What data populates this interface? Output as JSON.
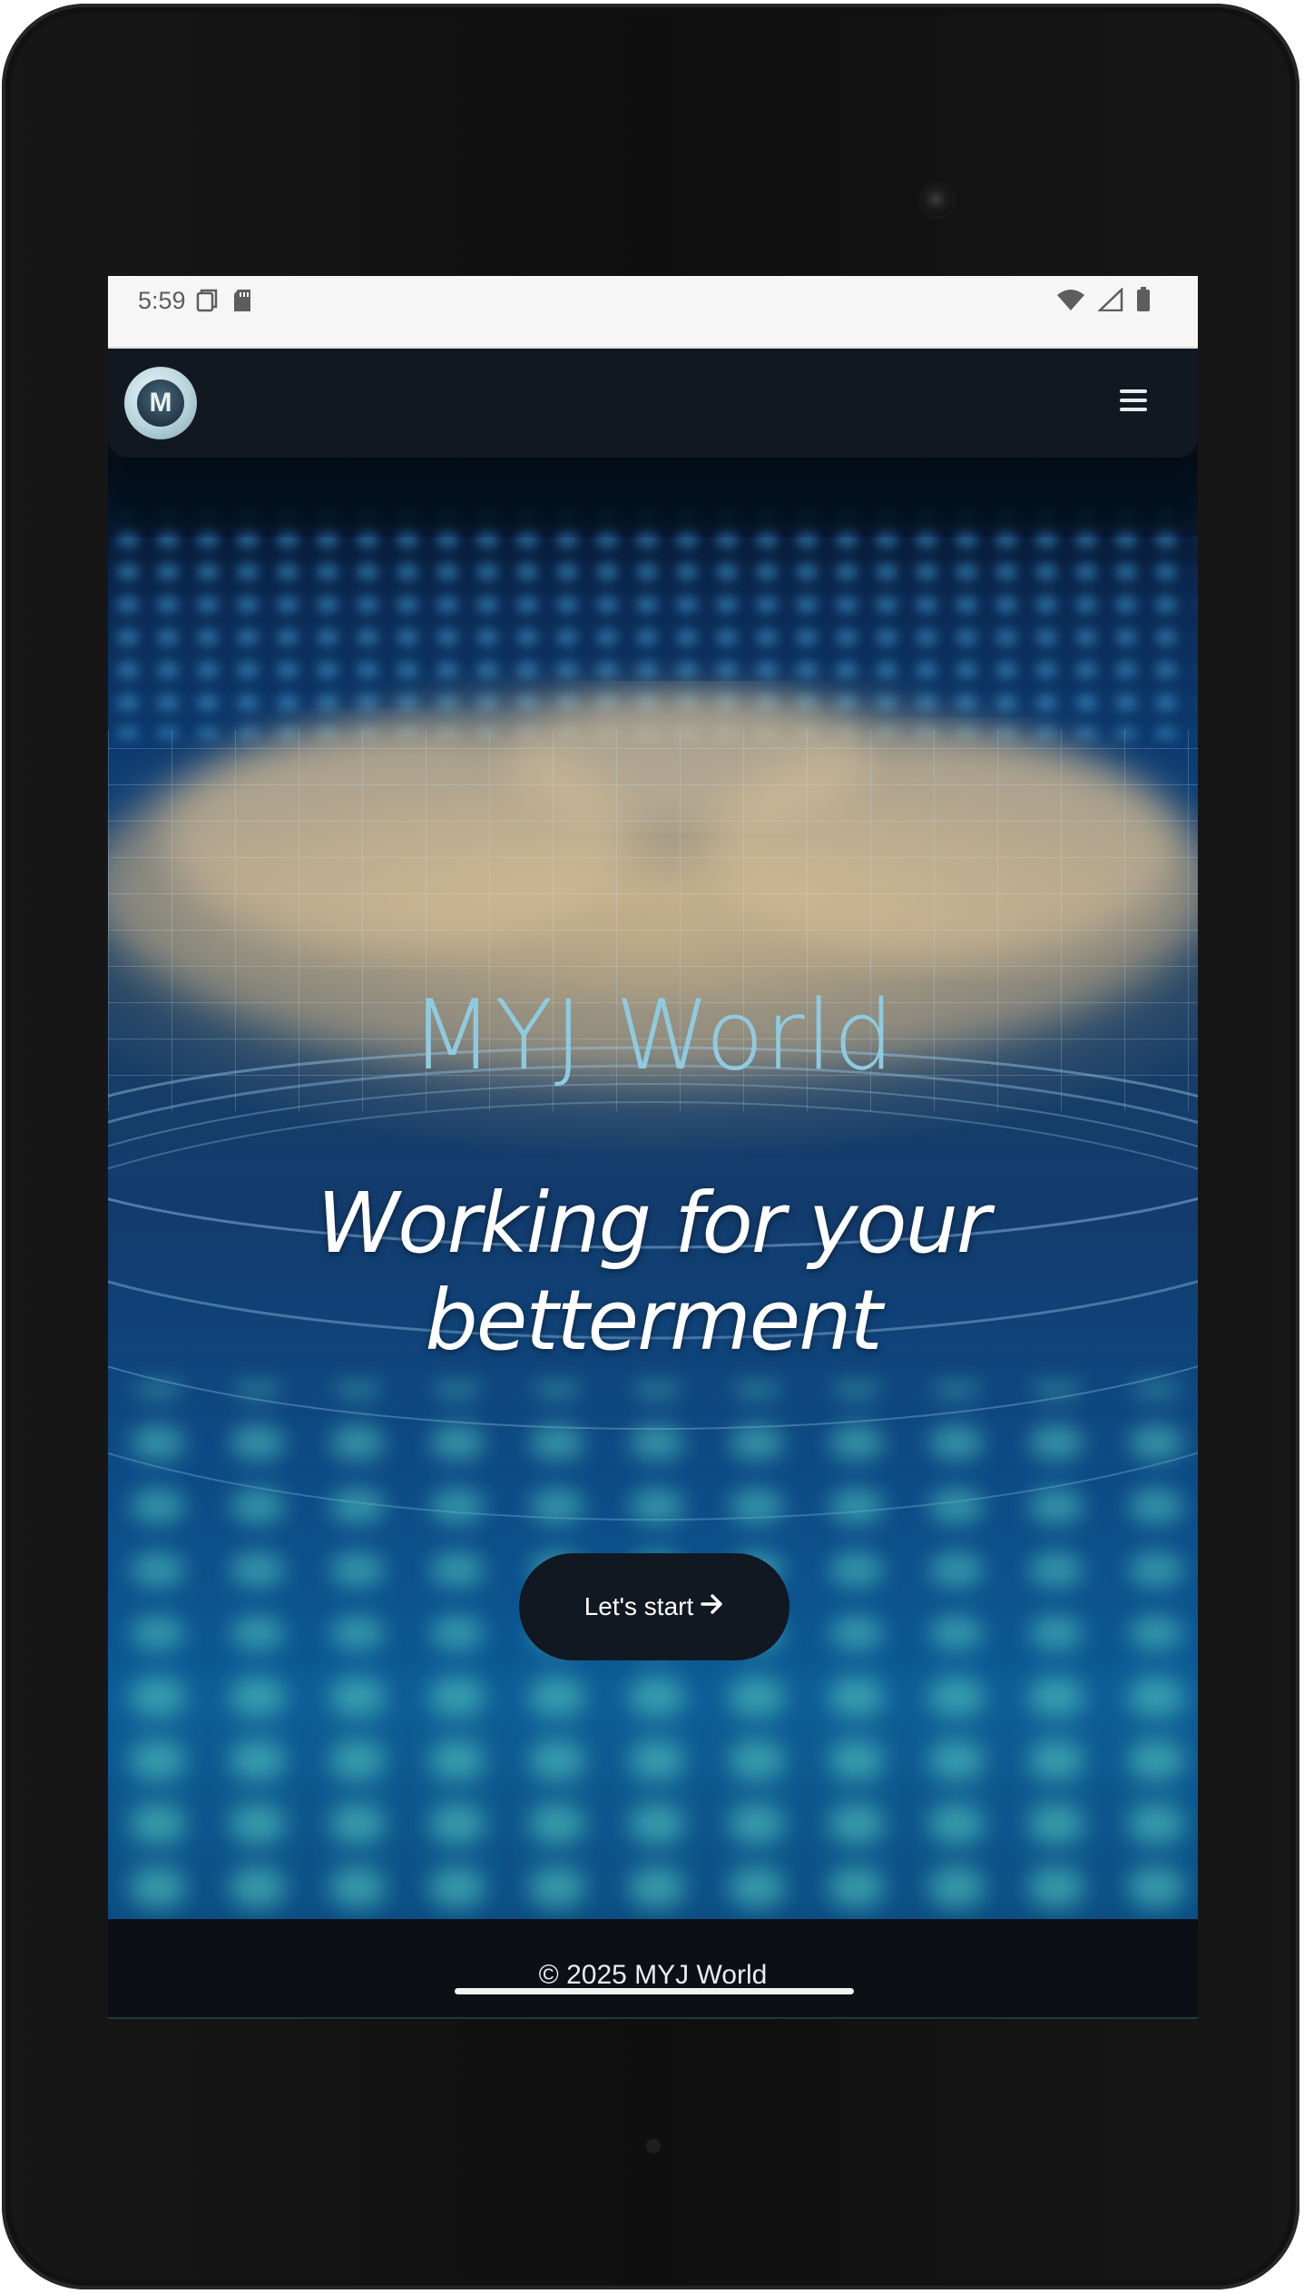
{
  "status_bar": {
    "time": "5:59",
    "left_icons": [
      "screenshot-icon",
      "sd-card-icon"
    ],
    "right_icons": [
      "wifi-icon",
      "signal-icon",
      "battery-icon"
    ]
  },
  "navbar": {
    "logo_letter": "M",
    "menu_icon": "hamburger-menu-icon"
  },
  "hero": {
    "title": "MYJ World",
    "subtitle": "Working for your betterment",
    "cta_label": "Let's start",
    "cta_icon": "arrow-right-icon"
  },
  "footer": {
    "copyright": "© 2025 MYJ World"
  },
  "colors": {
    "title": "#8fcbe0",
    "navbar": "#121821",
    "cta_background": "#121821"
  }
}
